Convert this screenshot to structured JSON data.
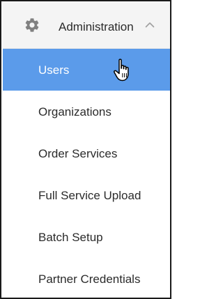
{
  "header": {
    "title": "Administration",
    "icon": "gear-icon",
    "toggle_icon": "chevron-up-icon",
    "expanded": true
  },
  "menu": {
    "items": [
      {
        "label": "Users",
        "active": true
      },
      {
        "label": "Organizations",
        "active": false
      },
      {
        "label": "Order Services",
        "active": false
      },
      {
        "label": "Full Service Upload",
        "active": false
      },
      {
        "label": "Batch Setup",
        "active": false
      },
      {
        "label": "Partner Credentials",
        "active": false
      }
    ]
  },
  "colors": {
    "active_background": "#5b9bea",
    "header_background": "#f4f4f4",
    "text": "#2b2b2b",
    "active_text": "#ffffff",
    "icon": "#808080"
  },
  "cursor": "hand-pointer-cursor-icon"
}
